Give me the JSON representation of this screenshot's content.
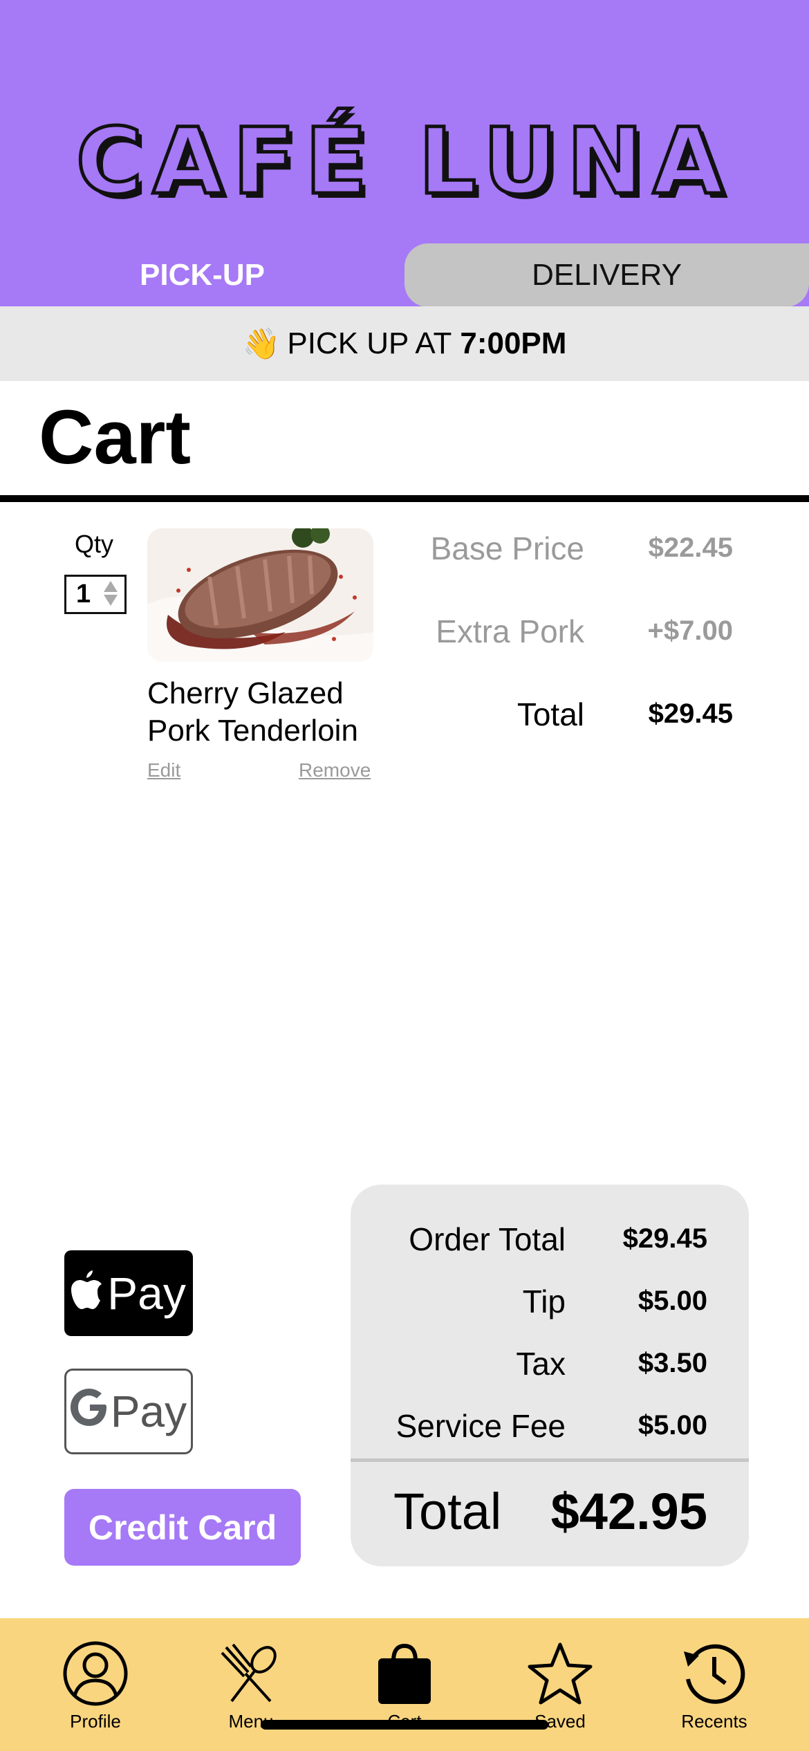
{
  "header": {
    "logo_text": "CAFÉ LUNA",
    "brand_color": "#a679f6"
  },
  "tabs": [
    {
      "label": "PICK-UP",
      "active": true
    },
    {
      "label": "DELIVERY",
      "active": false
    }
  ],
  "pickup_banner": {
    "icon": "waving-hand-icon",
    "emoji": "👋",
    "prefix": "PICK UP AT",
    "time": "7:00PM"
  },
  "cart": {
    "title": "Cart",
    "item": {
      "qty_label": "Qty",
      "qty_value": "1",
      "image": "food-photo-pork-tenderloin",
      "name": "Cherry Glazed Pork Tenderloin",
      "edit_label": "Edit",
      "remove_label": "Remove",
      "prices": [
        {
          "label": "Base Price",
          "value": "$22.45",
          "muted": true
        },
        {
          "label": "Extra Pork",
          "value": "+$7.00",
          "muted": true
        },
        {
          "label": "Total",
          "value": "$29.45",
          "muted": false
        }
      ]
    }
  },
  "payment": {
    "apple_pay_label": "Pay",
    "google_pay_label": "Pay",
    "credit_card_label": "Credit Card"
  },
  "summary": {
    "rows": [
      {
        "label": "Order Total",
        "value": "$29.45"
      },
      {
        "label": "Tip",
        "value": "$5.00"
      },
      {
        "label": "Tax",
        "value": "$3.50"
      },
      {
        "label": "Service Fee",
        "value": "$5.00"
      }
    ],
    "total_label": "Total",
    "total_value": "$42.95"
  },
  "nav": [
    {
      "label": "Profile",
      "icon": "person-icon"
    },
    {
      "label": "Menu",
      "icon": "fork-knife-icon"
    },
    {
      "label": "Cart",
      "icon": "shopping-bag-icon",
      "active": true
    },
    {
      "label": "Saved",
      "icon": "star-icon"
    },
    {
      "label": "Recents",
      "icon": "history-clock-icon"
    }
  ],
  "colors": {
    "purple": "#a679f6",
    "nav_yellow": "#f9d57f",
    "light_gray": "#e8e8e8",
    "tab_gray": "#c4c4c4"
  }
}
